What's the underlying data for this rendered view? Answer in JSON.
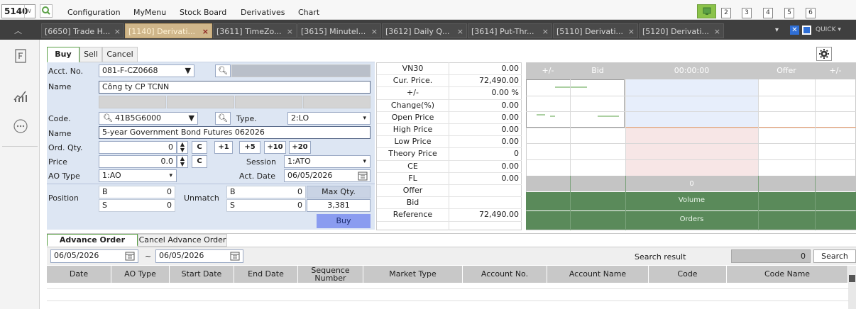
{
  "topbar": {
    "screen_code": "5140",
    "menu": [
      "Configuration",
      "MyMenu",
      "Stock Board",
      "Derivatives",
      "Chart"
    ],
    "screen_numbers": [
      "2",
      "3",
      "4",
      "5",
      "6"
    ]
  },
  "tabs": [
    {
      "label": "[6650] Trade H...",
      "active": false
    },
    {
      "label": "[1140] Derivati...",
      "active": true
    },
    {
      "label": "[3611] TimeZo...",
      "active": false
    },
    {
      "label": "[3615] Minutel...",
      "active": false
    },
    {
      "label": "[3612] Daily Q...",
      "active": false
    },
    {
      "label": "[3614] Put-Thr...",
      "active": false
    },
    {
      "label": "[5110] Derivati...",
      "active": false
    },
    {
      "label": "[5120] Derivati...",
      "active": false
    }
  ],
  "tab_close": "×",
  "quick_label": "QUICK ▾",
  "order": {
    "tabs": [
      "Buy",
      "Sell",
      "Cancel"
    ],
    "acct_label": "Acct. No.",
    "acct_value": "081-F-CZ0668",
    "name_label": "Name",
    "name_value": "Công ty CP TCNN",
    "code_label": "Code.",
    "code_value": "41B5G6000",
    "type_label": "Type.",
    "type_value": "2:LO",
    "name2_label": "Name",
    "name2_value": "5-year Government Bond  Futures 062026",
    "qty_label": "Ord. Qty.",
    "qty_value": "0",
    "clear_label": "C",
    "qty_buttons": [
      "+1",
      "+5",
      "+10",
      "+20"
    ],
    "price_label": "Price",
    "price_value": "0.0",
    "session_label": "Session",
    "session_value": "1:ATO",
    "aotype_label": "AO Type",
    "aotype_value": "1:AO",
    "actdate_label": "Act. Date",
    "actdate_value": "06/05/2026",
    "position_label": "Position",
    "unmatch_label": "Unmatch",
    "b": "B",
    "s": "S",
    "pos_b": "0",
    "pos_s": "0",
    "unm_b": "0",
    "unm_s": "0",
    "maxqty_label": "Max Qty.",
    "maxqty_value": "3,381",
    "buy_button": "Buy"
  },
  "quote": {
    "rows": [
      {
        "label": "VN30",
        "value": "0.00"
      },
      {
        "label": "Cur. Price.",
        "value": "72,490.00"
      },
      {
        "label": "+/-",
        "value": ""
      },
      {
        "label": "Change(%)",
        "value": "0.00"
      },
      {
        "label": "Open Price",
        "value": "0.00"
      },
      {
        "label": "High Price",
        "value": "0.00"
      },
      {
        "label": "Low Price",
        "value": "0.00"
      },
      {
        "label": "Theory Price",
        "value": "0"
      },
      {
        "label": "CE",
        "value": "0.00"
      },
      {
        "label": "FL",
        "value": "0.00"
      },
      {
        "label": "Offer",
        "value": ""
      },
      {
        "label": "Bid",
        "value": ""
      },
      {
        "label": "Reference",
        "value": "72,490.00"
      }
    ],
    "change_pct": "0.00 %"
  },
  "orderbook": {
    "headers": [
      "+/-",
      "Bid",
      "00:00:00",
      "Offer",
      "+/-"
    ],
    "total_value": "0",
    "volume_label": "Volume",
    "orders_label": "Orders"
  },
  "history": {
    "tabs": [
      "Advance Order History",
      "Cancel Advance Order"
    ],
    "date_from": "06/05/2026",
    "range_sep": "~",
    "date_to": "06/05/2026",
    "search_result_label": "Search result",
    "search_count": "0",
    "search_button": "Search",
    "columns": [
      "Date",
      "AO Type",
      "Start Date",
      "End Date",
      "Sequence Number",
      "Market Type",
      "Account No.",
      "Account Name",
      "Code",
      "Code Name"
    ]
  },
  "colors": {
    "accent_green": "#5aa046",
    "active_tab": "#cfb68a",
    "buy_blue": "#8a9cf0",
    "panel_blue": "#dde6f3"
  }
}
